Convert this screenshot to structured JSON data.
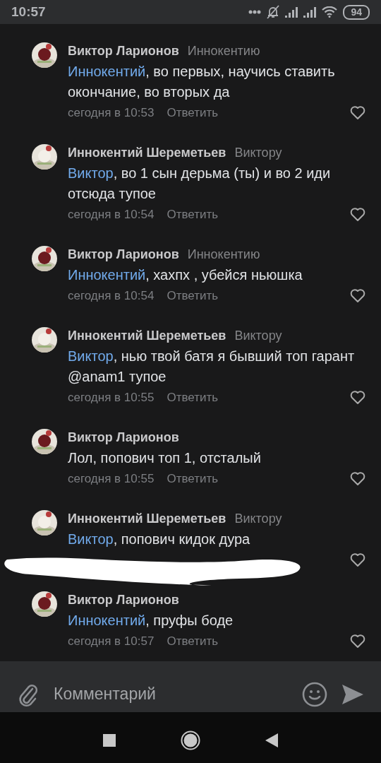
{
  "status_bar": {
    "time": "10:57",
    "battery": "94"
  },
  "comments": [
    {
      "author": "Виктор Ларионов",
      "reply_to": "Иннокентию",
      "mention": "Иннокентий",
      "text": ", во первых, научись ставить окончание, во вторых да",
      "date": "сегодня в 10:53",
      "reply": "Ответить",
      "redacted": false
    },
    {
      "author": "Иннокентий Шереметьев",
      "reply_to": "Виктору",
      "mention": "Виктор",
      "text": ", во 1 сын дерьма (ты) и во 2 иди отсюда тупое",
      "date": "сегодня в 10:54",
      "reply": "Ответить",
      "redacted": false
    },
    {
      "author": "Виктор Ларионов",
      "reply_to": "Иннокентию",
      "mention": "Иннокентий",
      "text": ", хахпх , убейся ньюшка",
      "date": "сегодня в 10:54",
      "reply": "Ответить",
      "redacted": false
    },
    {
      "author": "Иннокентий Шереметьев",
      "reply_to": "Виктору",
      "mention": "Виктор",
      "text": ", нью твой батя я бывший топ гарант @anam1 тупое",
      "date": "сегодня в 10:55",
      "reply": "Ответить",
      "redacted": false
    },
    {
      "author": "Виктор Ларионов",
      "text": "Лол, попович топ 1, отсталый",
      "date": "сегодня в 10:55",
      "reply": "Ответить",
      "redacted": false
    },
    {
      "author": "Иннокентий Шереметьев",
      "reply_to": "Виктору",
      "mention": "Виктор",
      "text": ", попович кидок дура",
      "redacted": true
    },
    {
      "author": "Виктор Ларионов",
      "mention": "Иннокентий",
      "text": ", пруфы боде",
      "date": "сегодня в 10:57",
      "reply": "Ответить",
      "redacted": false
    }
  ],
  "composer": {
    "placeholder": "Комментарий"
  }
}
